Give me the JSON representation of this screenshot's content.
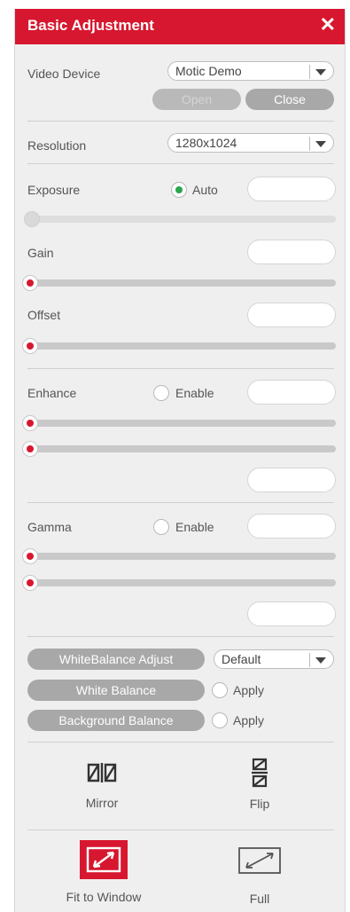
{
  "title": "Basic Adjustment",
  "close_glyph": "✕",
  "video_device": {
    "label": "Video Device",
    "value": "Motic Demo",
    "open_label": "Open",
    "close_label": "Close"
  },
  "resolution": {
    "label": "Resolution",
    "value": "1280x1024"
  },
  "exposure": {
    "label": "Exposure",
    "auto_label": "Auto",
    "auto_checked": true,
    "level": 0
  },
  "gain": {
    "label": "Gain",
    "level": 0
  },
  "offset": {
    "label": "Offset",
    "level": 0
  },
  "enhance": {
    "label": "Enhance",
    "enable_label": "Enable",
    "slider1": 0,
    "slider2": 0
  },
  "gamma": {
    "label": "Gamma",
    "enable_label": "Enable",
    "slider1": 0,
    "slider2": 0
  },
  "white_balance": {
    "adjust_label": "WhiteBalance Adjust",
    "adjust_value": "Default",
    "white_balance_label": "White Balance",
    "background_balance_label": "Background Balance",
    "apply_label": "Apply"
  },
  "tools": {
    "mirror_label": "Mirror",
    "flip_label": "Flip",
    "fit_label": "Fit to Window",
    "full_label": "Full"
  },
  "colors": {
    "accent": "#d7172f",
    "panel": "#efefef",
    "radio_on": "#2ca54b",
    "pill": "#a8a8a8"
  }
}
